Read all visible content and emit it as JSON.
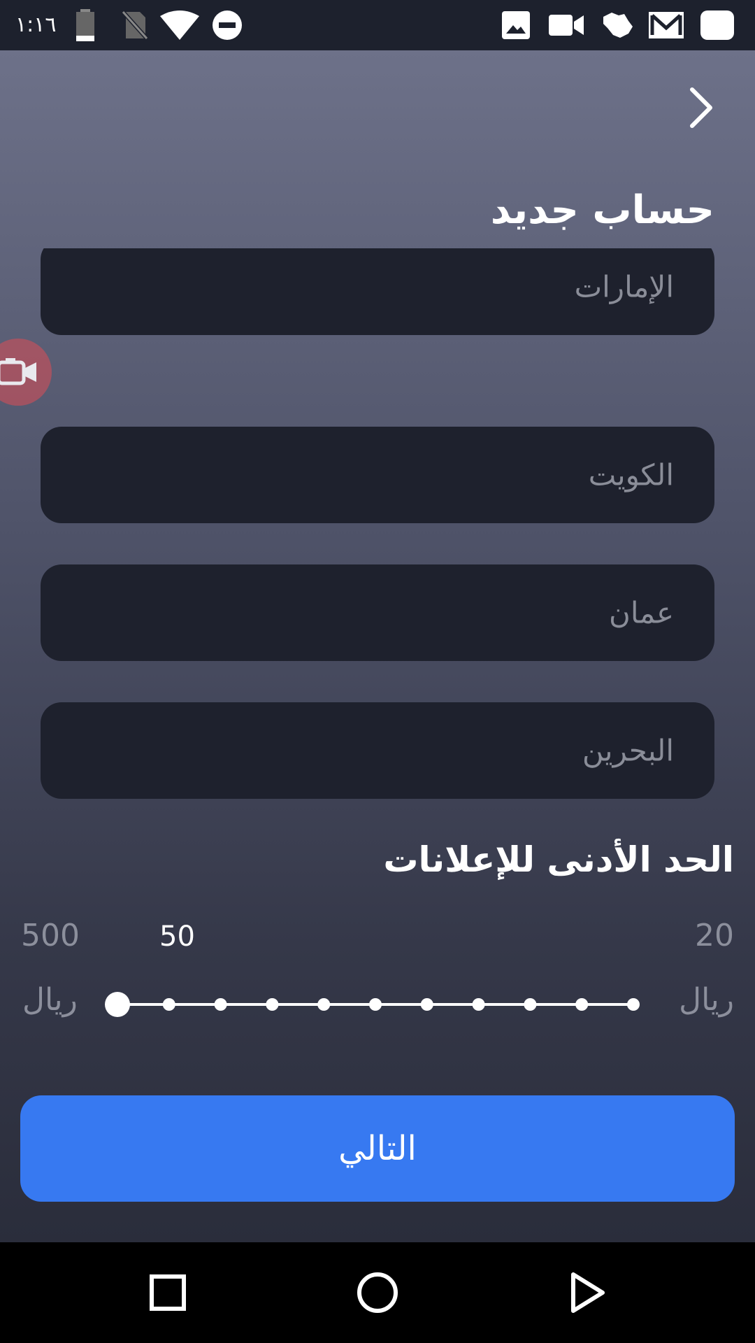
{
  "status_bar": {
    "time": "١:١٦",
    "icons": [
      "battery-icon",
      "no-sim-icon",
      "wifi-icon",
      "do-not-disturb-icon",
      "image-icon",
      "video-camera-icon",
      "saudi-map-icon",
      "gmail-icon",
      "notification-icon"
    ]
  },
  "header": {
    "back_icon": "chevron-right-icon",
    "title": "حساب جديد"
  },
  "countries": [
    {
      "label": "الإمارات"
    },
    {
      "label": "الكويت"
    },
    {
      "label": "عمان"
    },
    {
      "label": "البحرين"
    }
  ],
  "floating": {
    "icon": "screen-record-icon"
  },
  "min_ads": {
    "title": "الحد الأدنى للإعلانات",
    "min_value": "20",
    "max_value": "500",
    "current_value": "50",
    "currency_left": "ريال",
    "currency_right": "ريال",
    "steps": 11,
    "selected_index": 0
  },
  "next_button": {
    "label": "التالي"
  },
  "nav": {
    "icons": [
      "recents-square-icon",
      "home-circle-icon",
      "back-triangle-icon"
    ]
  },
  "colors": {
    "accent": "#3779f1",
    "field_bg": "#1e212d",
    "status_bar_bg": "#1d212d"
  }
}
